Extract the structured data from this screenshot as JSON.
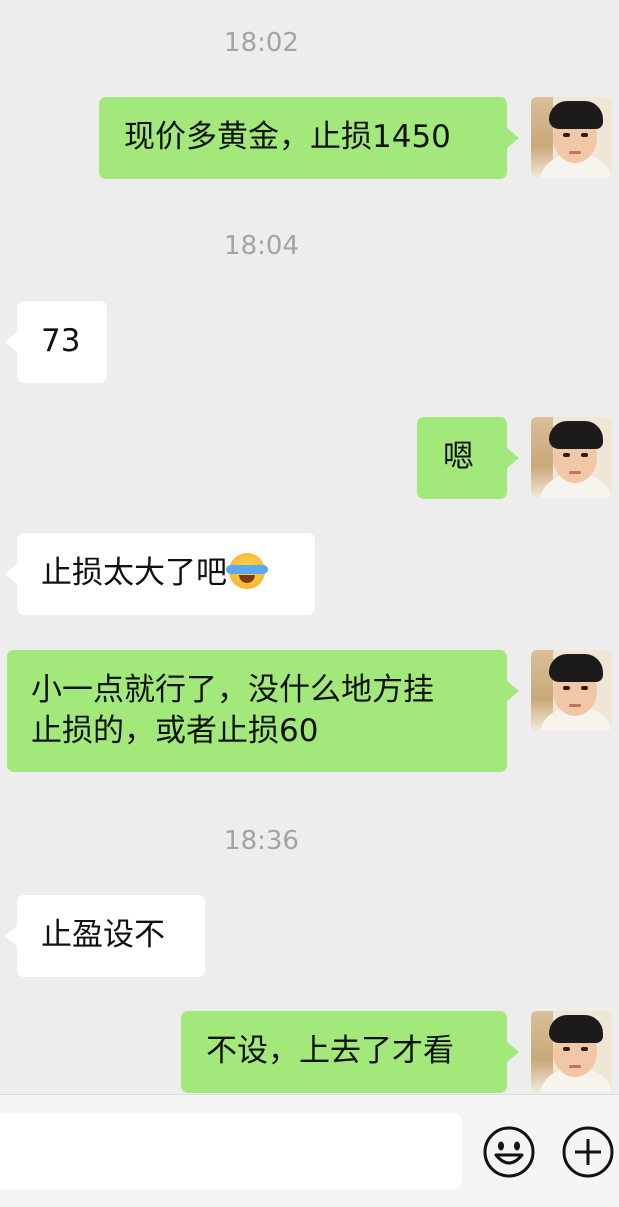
{
  "messages": [
    {
      "type": "time",
      "text": "18:02"
    },
    {
      "type": "sent",
      "text": "现价多黄金，止损1450"
    },
    {
      "type": "time",
      "text": "18:04"
    },
    {
      "type": "recv",
      "text": "73"
    },
    {
      "type": "sent",
      "text": "嗯"
    },
    {
      "type": "recv",
      "text": "止损太大了吧",
      "emoji": "face-with-tears-of-joy-icon"
    },
    {
      "type": "sent",
      "text": "小一点就行了，没什么地方挂\n止损的，或者止损60"
    },
    {
      "type": "time",
      "text": "18:36"
    },
    {
      "type": "recv",
      "text": "止盈设不"
    },
    {
      "type": "sent",
      "text": "不设，上去了才看"
    }
  ],
  "input": {
    "value": "",
    "emoji_button": "smiley-face-icon",
    "more_button": "plus-circle-icon"
  },
  "colors": {
    "background": "#ededed",
    "sent_bubble": "#a3e87a",
    "recv_bubble": "#ffffff",
    "timestamp": "#a3a3a3"
  }
}
